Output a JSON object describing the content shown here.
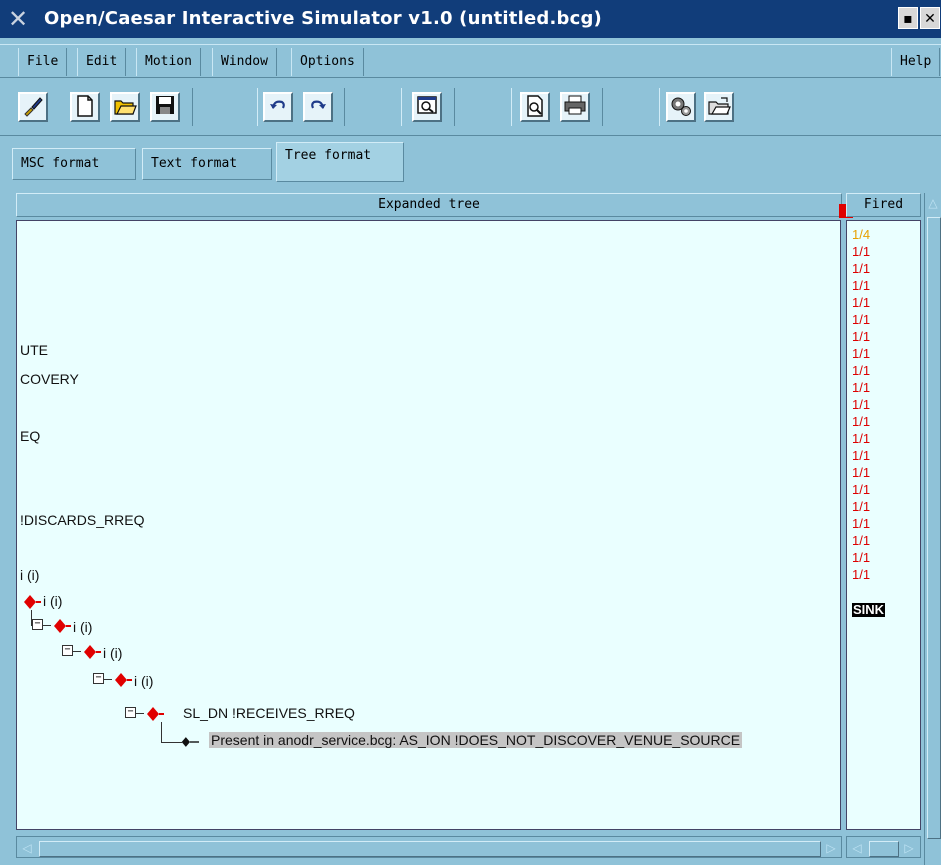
{
  "window": {
    "title": "Open/Caesar Interactive Simulator v1.0 (untitled.bcg)",
    "title_buttons": [
      "▪",
      "✕"
    ]
  },
  "menu": {
    "items": [
      "File",
      "Edit",
      "Motion",
      "Window",
      "Options"
    ],
    "help": "Help"
  },
  "toolbar": {
    "icons": [
      "brush-icon",
      "new-file-icon",
      "open-folder-icon",
      "save-icon",
      "undo-icon",
      "redo-icon",
      "window-zoom-icon",
      "print-preview-icon",
      "print-icon",
      "gears-icon",
      "open-file-icon"
    ]
  },
  "tabs": [
    {
      "label": "MSC format",
      "active": false
    },
    {
      "label": "Text format",
      "active": false
    },
    {
      "label": "Tree format",
      "active": true
    }
  ],
  "tree": {
    "header": "Expanded tree",
    "lines": [
      "UTE",
      "COVERY",
      "EQ",
      "!DISCARDS_RREQ",
      "i (i)"
    ],
    "nodes": [
      "i (i)",
      "i (i)",
      "i (i)",
      "i (i)",
      "SL_DN !RECEIVES_RREQ"
    ],
    "final": "Present in anodr_service.bcg: AS_ION !DOES_NOT_DISCOVER_VENUE_SOURCE"
  },
  "fired": {
    "header": "Fired",
    "items": [
      {
        "text": "1/4",
        "color": "#e8a000"
      },
      {
        "text": "1/1",
        "color": "#dd0000"
      },
      {
        "text": "1/1",
        "color": "#dd0000"
      },
      {
        "text": "1/1",
        "color": "#dd0000"
      },
      {
        "text": "1/1",
        "color": "#dd0000"
      },
      {
        "text": "1/1",
        "color": "#dd0000"
      },
      {
        "text": "1/1",
        "color": "#dd0000"
      },
      {
        "text": "1/1",
        "color": "#dd0000"
      },
      {
        "text": "1/1",
        "color": "#dd0000"
      },
      {
        "text": "1/1",
        "color": "#dd0000"
      },
      {
        "text": "1/1",
        "color": "#dd0000"
      },
      {
        "text": "1/1",
        "color": "#dd0000"
      },
      {
        "text": "1/1",
        "color": "#dd0000"
      },
      {
        "text": "1/1",
        "color": "#dd0000"
      },
      {
        "text": "1/1",
        "color": "#dd0000"
      },
      {
        "text": "1/1",
        "color": "#dd0000"
      },
      {
        "text": "1/1",
        "color": "#dd0000"
      },
      {
        "text": "1/1",
        "color": "#dd0000"
      },
      {
        "text": "1/1",
        "color": "#dd0000"
      },
      {
        "text": "1/1",
        "color": "#dd0000"
      },
      {
        "text": "1/1",
        "color": "#dd0000"
      }
    ],
    "sink": "SINK"
  },
  "colors": {
    "accent": "#8fc2d8",
    "panel_bg": "#eaffff",
    "titlebar": "#113d7a",
    "node_red": "#e00000"
  }
}
